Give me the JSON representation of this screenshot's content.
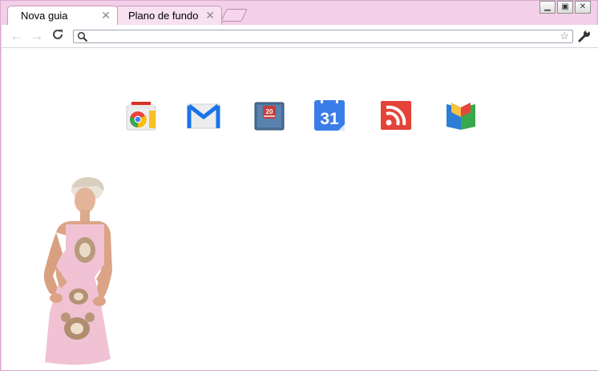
{
  "tabs": [
    {
      "label": "Nova guia",
      "active": true
    },
    {
      "label": "Plano de fundo",
      "active": false
    }
  ],
  "window_controls": {
    "minimize": "minimize-icon",
    "restore": "restore-icon",
    "close": "close-icon"
  },
  "toolbar": {
    "back_icon": "back-arrow-icon",
    "forward_icon": "forward-arrow-icon",
    "reload_icon": "reload-icon",
    "omnibox_value": "",
    "omnibox_placeholder": "",
    "wrench_icon": "wrench-icon"
  },
  "apps": [
    {
      "name": "Chrome Web Store",
      "icon": "web-store-icon"
    },
    {
      "name": "Gmail",
      "icon": "gmail-icon"
    },
    {
      "name": "Address Book",
      "icon": "address-book-icon",
      "badge_text": "20"
    },
    {
      "name": "Calendar",
      "icon": "calendar-icon",
      "day": "31"
    },
    {
      "name": "RSS Reader",
      "icon": "rss-icon"
    },
    {
      "name": "Books",
      "icon": "books-icon"
    }
  ],
  "theme": {
    "frame_color": "#f3cfe9",
    "accent": "#f0c9e6"
  }
}
